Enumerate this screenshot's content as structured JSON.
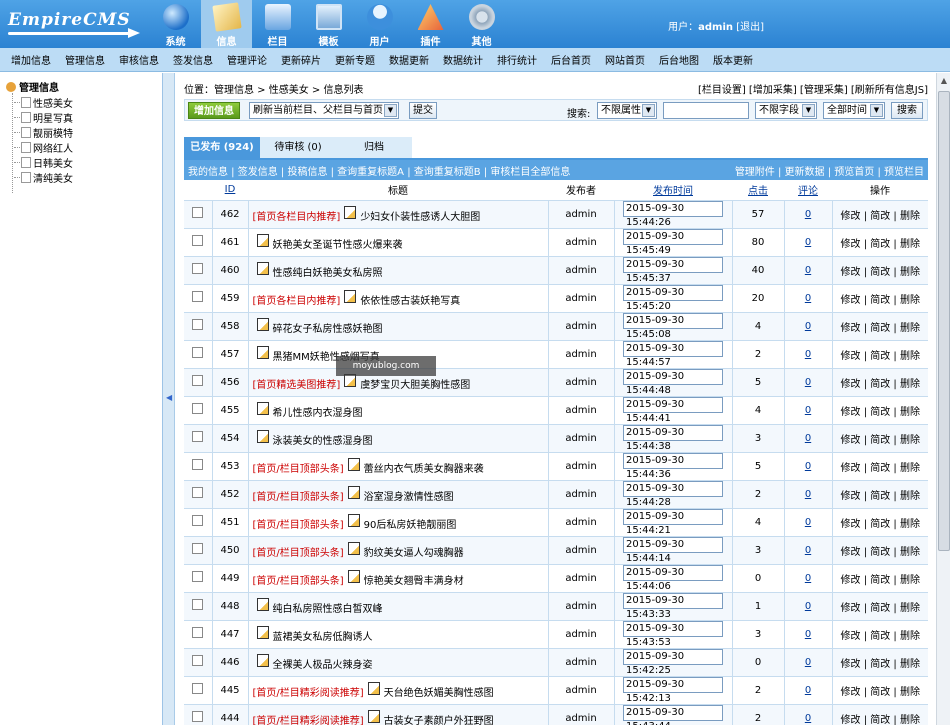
{
  "header": {
    "logo": "EmpireCMS",
    "nav": [
      {
        "label": "系统",
        "icon": "globe-icon"
      },
      {
        "label": "信息",
        "icon": "info-icon",
        "active": true
      },
      {
        "label": "栏目",
        "icon": "folder-icon"
      },
      {
        "label": "模板",
        "icon": "template-icon"
      },
      {
        "label": "用户",
        "icon": "user-icon"
      },
      {
        "label": "插件",
        "icon": "plugin-icon"
      },
      {
        "label": "其他",
        "icon": "gear-icon"
      }
    ],
    "user_prefix": "用户：",
    "username": "admin",
    "logout": "[退出]"
  },
  "subnav": [
    "增加信息",
    "管理信息",
    "审核信息",
    "签发信息",
    "管理评论",
    "更新碎片",
    "更新专题",
    "数据更新",
    "数据统计",
    "排行统计",
    "后台首页",
    "网站首页",
    "后台地图",
    "版本更新"
  ],
  "sidebar": {
    "root": "管理信息",
    "items": [
      "性感美女",
      "明星写真",
      "靓丽模特",
      "网络红人",
      "日韩美女",
      "清纯美女"
    ]
  },
  "breadcrumb": {
    "prefix": "位置：",
    "path": "管理信息 > 性感美女 > 信息列表",
    "actions": "[栏目设置] [增加采集] [管理采集] [刷新所有信息JS]"
  },
  "toolbar": {
    "add_button": "增加信息",
    "refresh_select": "刷新当前栏目、父栏目与首页",
    "submit": "提交",
    "search_label": "搜索:",
    "attr_select": "不限属性",
    "field_select": "不限字段",
    "time_select": "全部时间",
    "search_button": "搜索"
  },
  "tabs": [
    "已发布 (924)",
    "待审核 (0)",
    "归档"
  ],
  "table_links": {
    "left": "我的信息 | 签发信息 | 投稿信息 | 查询重复标题A | 查询重复标题B | 审核栏目全部信息",
    "right": "管理附件 | 更新数据 | 预览首页 | 预览栏目"
  },
  "columns": [
    "ID",
    "标题",
    "发布者",
    "发布时间",
    "点击",
    "评论",
    "操作"
  ],
  "ops_label": "修改 | 简改 | 删除",
  "rows": [
    {
      "id": "462",
      "tag": "[首页各栏目内推荐]",
      "title": "少妇女仆装性感诱人大胆图",
      "pub": "admin",
      "time": "2015-09-30 15:44:26",
      "clicks": "57",
      "cmt": "0"
    },
    {
      "id": "461",
      "tag": "",
      "title": "妖艳美女圣诞节性感火爆来袭",
      "pub": "admin",
      "time": "2015-09-30 15:45:49",
      "clicks": "80",
      "cmt": "0"
    },
    {
      "id": "460",
      "tag": "",
      "title": "性感纯白妖艳美女私房照",
      "pub": "admin",
      "time": "2015-09-30 15:45:37",
      "clicks": "40",
      "cmt": "0"
    },
    {
      "id": "459",
      "tag": "[首页各栏目内推荐]",
      "title": "依依性感古装妖艳写真",
      "pub": "admin",
      "time": "2015-09-30 15:45:20",
      "clicks": "20",
      "cmt": "0"
    },
    {
      "id": "458",
      "tag": "",
      "title": "碎花女子私房性感妖艳图",
      "pub": "admin",
      "time": "2015-09-30 15:45:08",
      "clicks": "4",
      "cmt": "0"
    },
    {
      "id": "457",
      "tag": "",
      "title": "黑猪MM妖艳性感烟写真",
      "pub": "admin",
      "time": "2015-09-30 15:44:57",
      "clicks": "2",
      "cmt": "0"
    },
    {
      "id": "456",
      "tag": "[首页精选美图推荐]",
      "title": "虞梦宝贝大胆美胸性感图",
      "pub": "admin",
      "time": "2015-09-30 15:44:48",
      "clicks": "5",
      "cmt": "0"
    },
    {
      "id": "455",
      "tag": "",
      "title": "希儿性感内衣湿身图",
      "pub": "admin",
      "time": "2015-09-30 15:44:41",
      "clicks": "4",
      "cmt": "0"
    },
    {
      "id": "454",
      "tag": "",
      "title": "泳装美女的性感湿身图",
      "pub": "admin",
      "time": "2015-09-30 15:44:38",
      "clicks": "3",
      "cmt": "0"
    },
    {
      "id": "453",
      "tag": "[首页/栏目顶部头条]",
      "title": "蕾丝内衣气质美女胸器来袭",
      "pub": "admin",
      "time": "2015-09-30 15:44:36",
      "clicks": "5",
      "cmt": "0"
    },
    {
      "id": "452",
      "tag": "[首页/栏目顶部头条]",
      "title": "浴室湿身激情性感图",
      "pub": "admin",
      "time": "2015-09-30 15:44:28",
      "clicks": "2",
      "cmt": "0"
    },
    {
      "id": "451",
      "tag": "[首页/栏目顶部头条]",
      "title": "90后私房妖艳靓丽图",
      "pub": "admin",
      "time": "2015-09-30 15:44:21",
      "clicks": "4",
      "cmt": "0"
    },
    {
      "id": "450",
      "tag": "[首页/栏目顶部头条]",
      "title": "豹纹美女逼人勾魂胸器",
      "pub": "admin",
      "time": "2015-09-30 15:44:14",
      "clicks": "3",
      "cmt": "0"
    },
    {
      "id": "449",
      "tag": "[首页/栏目顶部头条]",
      "title": "惊艳美女翘臀丰满身材",
      "pub": "admin",
      "time": "2015-09-30 15:44:06",
      "clicks": "0",
      "cmt": "0"
    },
    {
      "id": "448",
      "tag": "",
      "title": "纯白私房照性感白皙双峰",
      "pub": "admin",
      "time": "2015-09-30 15:43:33",
      "clicks": "1",
      "cmt": "0"
    },
    {
      "id": "447",
      "tag": "",
      "title": "蓝裙美女私房低胸诱人",
      "pub": "admin",
      "time": "2015-09-30 15:43:53",
      "clicks": "3",
      "cmt": "0"
    },
    {
      "id": "446",
      "tag": "",
      "title": "全裸美人极品火辣身姿",
      "pub": "admin",
      "time": "2015-09-30 15:42:25",
      "clicks": "0",
      "cmt": "0"
    },
    {
      "id": "445",
      "tag": "[首页/栏目精彩阅读推荐]",
      "title": "天台绝色妖媚美胸性感图",
      "pub": "admin",
      "time": "2015-09-30 15:42:13",
      "clicks": "2",
      "cmt": "0"
    },
    {
      "id": "444",
      "tag": "[首页/栏目精彩阅读推荐]",
      "title": "古装女子素颜户外狂野图",
      "pub": "admin",
      "time": "2015-09-30 15:43:44",
      "clicks": "2",
      "cmt": "0"
    }
  ],
  "watermark": "moyublog.com"
}
